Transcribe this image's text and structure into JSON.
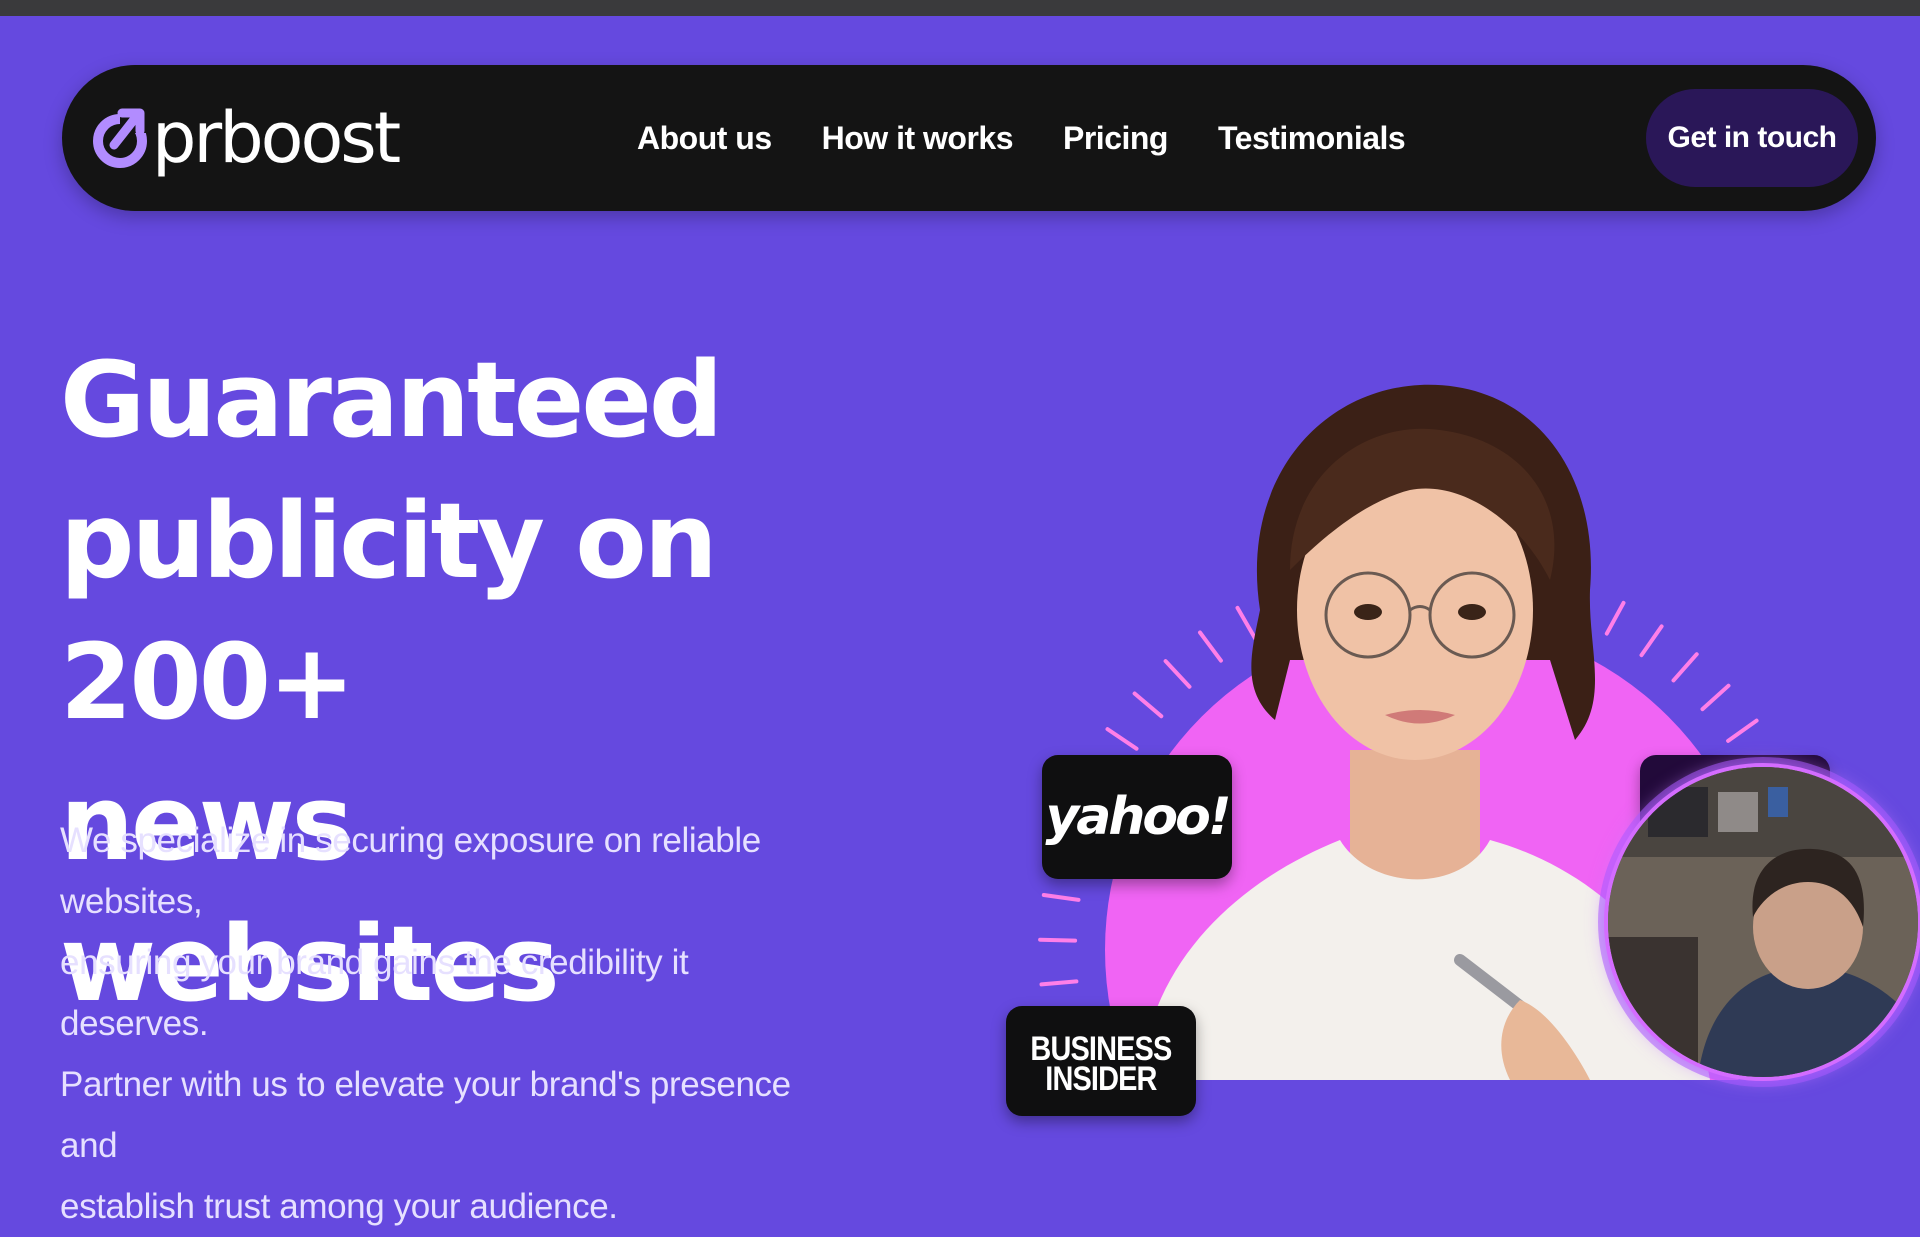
{
  "brand": {
    "name": "prboost",
    "accent": "#b28cff"
  },
  "nav": {
    "links": [
      "About us",
      "How it works",
      "Pricing",
      "Testimonials"
    ],
    "cta": "Get in touch"
  },
  "hero": {
    "title_lines": [
      "Guaranteed",
      "publicity on 200+",
      "news websites"
    ],
    "description_lines": [
      "We specialize in securing exposure on reliable websites,",
      "ensuring your brand gains the credibility it deserves.",
      "Partner with us to elevate your brand's presence and",
      "establish trust among your audience."
    ]
  },
  "media_badges": {
    "yahoo": "yahoo!",
    "business_insider": [
      "BUSINESS",
      "INSIDER"
    ]
  },
  "colors": {
    "background": "#6549df",
    "nav_bg": "#141414",
    "cta_bg": "#2a1758",
    "circle": "#f064f4",
    "webcam_ring": "#d46cff"
  }
}
